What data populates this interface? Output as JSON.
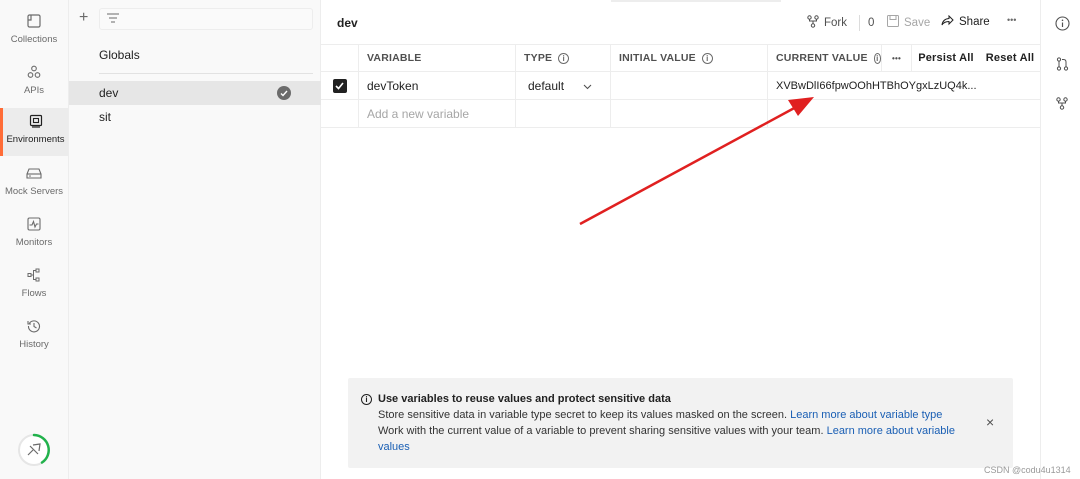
{
  "rail": {
    "items": [
      {
        "label": "Collections",
        "icon": "collections-icon"
      },
      {
        "label": "APIs",
        "icon": "apis-icon"
      },
      {
        "label": "Environments",
        "icon": "environments-icon",
        "active": true
      },
      {
        "label": "Mock Servers",
        "icon": "mock-servers-icon"
      },
      {
        "label": "Monitors",
        "icon": "monitors-icon"
      },
      {
        "label": "Flows",
        "icon": "flows-icon"
      },
      {
        "label": "History",
        "icon": "history-icon"
      }
    ]
  },
  "env_panel": {
    "add_symbol": "+",
    "globals_label": "Globals",
    "environments": [
      {
        "name": "dev",
        "selected": true
      },
      {
        "name": "sit",
        "selected": false
      }
    ]
  },
  "main": {
    "title": "dev",
    "fork_label": "Fork",
    "fork_count": "0",
    "save_label": "Save",
    "share_label": "Share",
    "more_label": "•••"
  },
  "table": {
    "headers": {
      "variable": "VARIABLE",
      "type": "TYPE",
      "initial_value": "INITIAL VALUE",
      "current_value": "CURRENT VALUE",
      "more": "•••",
      "persist_all": "Persist All",
      "reset_all": "Reset All"
    },
    "rows": [
      {
        "checked": true,
        "variable": "devToken",
        "type": "default",
        "initial_value": "",
        "current_value": "XVBwDlI66fpwOOhHTBhOYgxLzUQ4k..."
      }
    ],
    "add_placeholder": "Add a new variable"
  },
  "banner": {
    "title": "Use variables to reuse values and protect sensitive data",
    "line1_text": "Store sensitive data in variable type secret to keep its values masked on the screen. ",
    "line1_link": "Learn more about variable type",
    "line2_text": "Work with the current value of a variable to prevent sharing sensitive values with your team. ",
    "line2_link": "Learn more about variable",
    "line3_link": "values",
    "close_symbol": "×"
  },
  "watermark": "CSDN @codu4u1314",
  "colors": {
    "accent": "#ff6c37",
    "link": "#1a5fb4",
    "arrow": "#e02020"
  }
}
